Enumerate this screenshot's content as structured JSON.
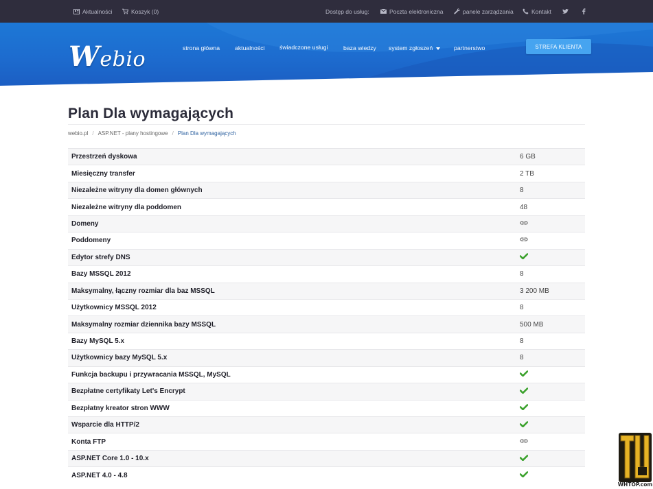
{
  "topbar": {
    "news": "Aktualności",
    "cart": "Koszyk (0)",
    "access": "Dostęp do usług:",
    "email": "Poczta elektroniczna",
    "panels": "panele zarządzania",
    "contact": "Kontakt"
  },
  "logo": {
    "first": "W",
    "rest": "ebio"
  },
  "nav": {
    "items": [
      "strona główna",
      "aktualności",
      "świadczone usługi",
      "baza wiedzy",
      "system zgłoszeń",
      "partnerstwo"
    ],
    "client_button": "STREFA KLIENTA"
  },
  "page": {
    "title": "Plan Dla wymagających"
  },
  "breadcrumb": [
    "webio.pl",
    "ASP.NET - plany hostingowe",
    "Plan Dla wymagających"
  ],
  "specs": [
    {
      "label": "Przestrzeń dyskowa",
      "value": "6 GB"
    },
    {
      "label": "Miesięczny transfer",
      "value": "2 TB"
    },
    {
      "label": "Niezależne witryny dla domen głównych",
      "value": "8"
    },
    {
      "label": "Niezależne witryny dla poddomen",
      "value": "48"
    },
    {
      "label": "Domeny",
      "icon": "link-icon"
    },
    {
      "label": "Poddomeny",
      "icon": "link-icon"
    },
    {
      "label": "Edytor strefy DNS",
      "icon": "check-icon"
    },
    {
      "label": "Bazy MSSQL 2012",
      "value": "8"
    },
    {
      "label": "Maksymalny, łączny rozmiar dla baz MSSQL",
      "value": "3 200 MB"
    },
    {
      "label": "Użytkownicy MSSQL 2012",
      "value": "8"
    },
    {
      "label": "Maksymalny rozmiar dziennika bazy MSSQL",
      "value": "500 MB"
    },
    {
      "label": "Bazy MySQL 5.x",
      "value": "8"
    },
    {
      "label": "Użytkownicy bazy MySQL 5.x",
      "value": "8"
    },
    {
      "label": "Funkcja backupu i przywracania MSSQL, MySQL",
      "icon": "check-icon"
    },
    {
      "label": "Bezpłatne certyfikaty Let's Encrypt",
      "icon": "check-icon"
    },
    {
      "label": "Bezpłatny kreator stron WWW",
      "icon": "check-icon"
    },
    {
      "label": "Wsparcie dla HTTP/2",
      "icon": "check-icon"
    },
    {
      "label": "Konta FTP",
      "icon": "link-icon"
    },
    {
      "label": "ASP.NET Core 1.0 - 10.x",
      "icon": "check-icon"
    },
    {
      "label": "ASP.NET 4.0 - 4.8",
      "icon": "check-icon"
    }
  ],
  "watermark": {
    "text": "WHTOP.com"
  },
  "colors": {
    "topbar": "#2f2d3d",
    "header": "#1d6ccf",
    "button": "#46a4f0",
    "check": "#3aa12b"
  }
}
